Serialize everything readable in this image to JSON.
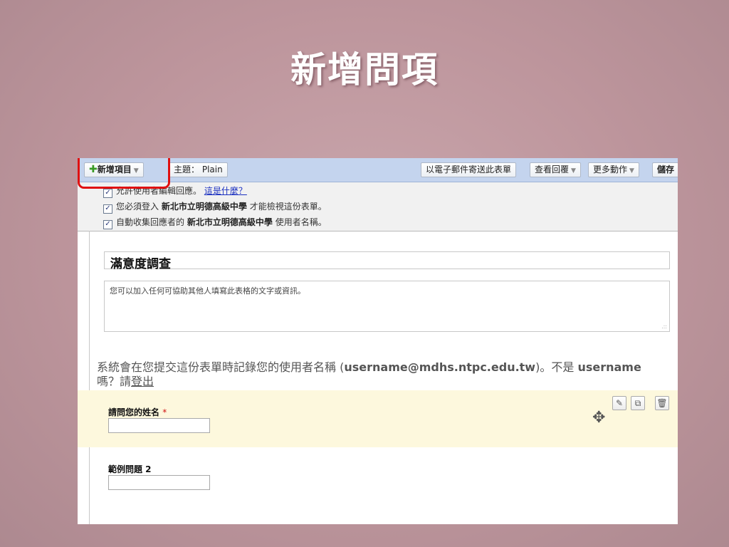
{
  "slide": {
    "title": "新增問項"
  },
  "toolbar": {
    "add_item": "新增項目",
    "theme_label": "主題：",
    "theme_value": "Plain",
    "email_form": "以電子郵件寄送此表單",
    "view_responses": "查看回覆",
    "more_actions": "更多動作",
    "save": "儲存"
  },
  "settings": {
    "allow_edit_text": "允許使用者編輯回應。",
    "allow_edit_link": "這是什麼？",
    "login_prefix": "您必須登入",
    "org_name": "新北市立明德高級中學",
    "login_suffix": "才能檢視這份表單。",
    "collect_prefix": "自動收集回應者的",
    "collect_suffix": "使用者名稱。"
  },
  "form": {
    "title": "滿意度調查",
    "description": "您可以加入任何可協助其他人填寫此表格的文字或資訊。"
  },
  "notice": {
    "prefix": "系統會在您提交這份表單時記錄您的使用者名稱 (",
    "email": "username@mdhs.ntpc.edu.tw",
    "middle": ")。不是",
    "username": "username",
    "suffix_1": "嗎？請",
    "logout": "登出"
  },
  "questions": [
    {
      "label": "請問您的姓名",
      "required_mark": "*"
    },
    {
      "label": "範例問題 2"
    }
  ],
  "icons": {
    "plus": "plus-icon",
    "caret": "chevron-down-icon",
    "edit": "pencil-icon",
    "duplicate": "duplicate-icon",
    "delete": "trash-icon",
    "move": "move-icon"
  },
  "colors": {
    "toolbar_bg": "#c4d4ee",
    "highlight_ring": "#e01010",
    "selected_question_bg": "#fdf8dd",
    "link": "#1a2fc0"
  }
}
